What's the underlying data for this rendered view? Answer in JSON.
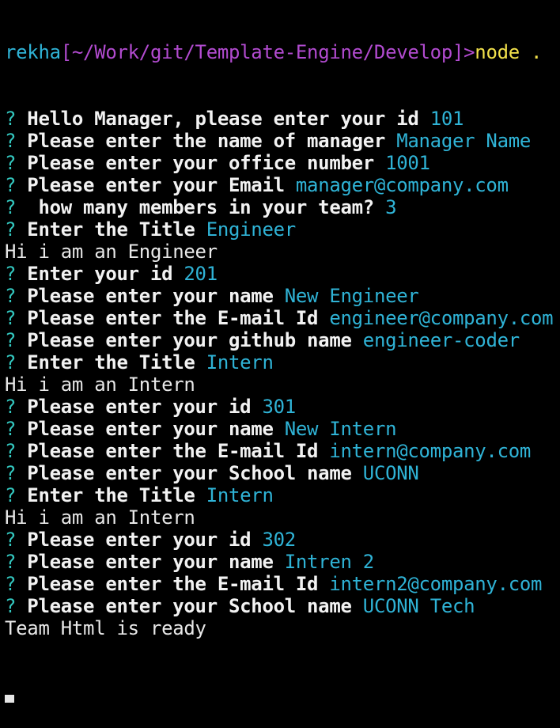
{
  "shell": {
    "user": "rekha",
    "open_bracket": "[",
    "path": "~/Work/git/Template-Engine/Develop",
    "close_bracket": "]",
    "gt": ">",
    "command": "node ."
  },
  "questions": [
    {
      "mark": "?",
      "prompt": " Hello Manager, please enter your id ",
      "answer": "101"
    },
    {
      "mark": "?",
      "prompt": " Please enter the name of manager ",
      "answer": "Manager Name"
    },
    {
      "mark": "?",
      "prompt": " Please enter your office number ",
      "answer": "1001"
    },
    {
      "mark": "?",
      "prompt": " Please enter your Email ",
      "answer": "manager@company.com"
    },
    {
      "mark": "?",
      "prompt": "  how many members in your team? ",
      "answer": "3"
    },
    {
      "mark": "?",
      "prompt": " Enter the Title ",
      "answer": "Engineer"
    },
    {
      "plain": "Hi i am an Engineer"
    },
    {
      "mark": "?",
      "prompt": " Enter your id ",
      "answer": "201"
    },
    {
      "mark": "?",
      "prompt": " Please enter your name ",
      "answer": "New Engineer"
    },
    {
      "mark": "?",
      "prompt": " Please enter the E-mail Id ",
      "answer": "engineer@company.com"
    },
    {
      "mark": "?",
      "prompt": " Please enter your github name ",
      "answer": "engineer-coder"
    },
    {
      "mark": "?",
      "prompt": " Enter the Title ",
      "answer": "Intern"
    },
    {
      "plain": "Hi i am an Intern"
    },
    {
      "mark": "?",
      "prompt": " Please enter your id ",
      "answer": "301"
    },
    {
      "mark": "?",
      "prompt": " Please enter your name ",
      "answer": "New Intern"
    },
    {
      "mark": "?",
      "prompt": " Please enter the E-mail Id ",
      "answer": "intern@company.com"
    },
    {
      "mark": "?",
      "prompt": " Please enter your School name ",
      "answer": "UCONN"
    },
    {
      "mark": "?",
      "prompt": " Enter the Title ",
      "answer": "Intern"
    },
    {
      "plain": "Hi i am an Intern"
    },
    {
      "mark": "?",
      "prompt": " Please enter your id ",
      "answer": "302"
    },
    {
      "mark": "?",
      "prompt": " Please enter your name ",
      "answer": "Intren 2"
    },
    {
      "mark": "?",
      "prompt": " Please enter the E-mail Id ",
      "answer": "intern2@company.com"
    },
    {
      "mark": "?",
      "prompt": " Please enter your School name ",
      "answer": "UCONN Tech"
    },
    {
      "plain": "Team Html is ready"
    }
  ],
  "colors": {
    "background": "#000000",
    "answer": "#2fb3d6",
    "question_mark": "#33c7bf",
    "path": "#b24bd0",
    "command": "#f2e14b"
  }
}
